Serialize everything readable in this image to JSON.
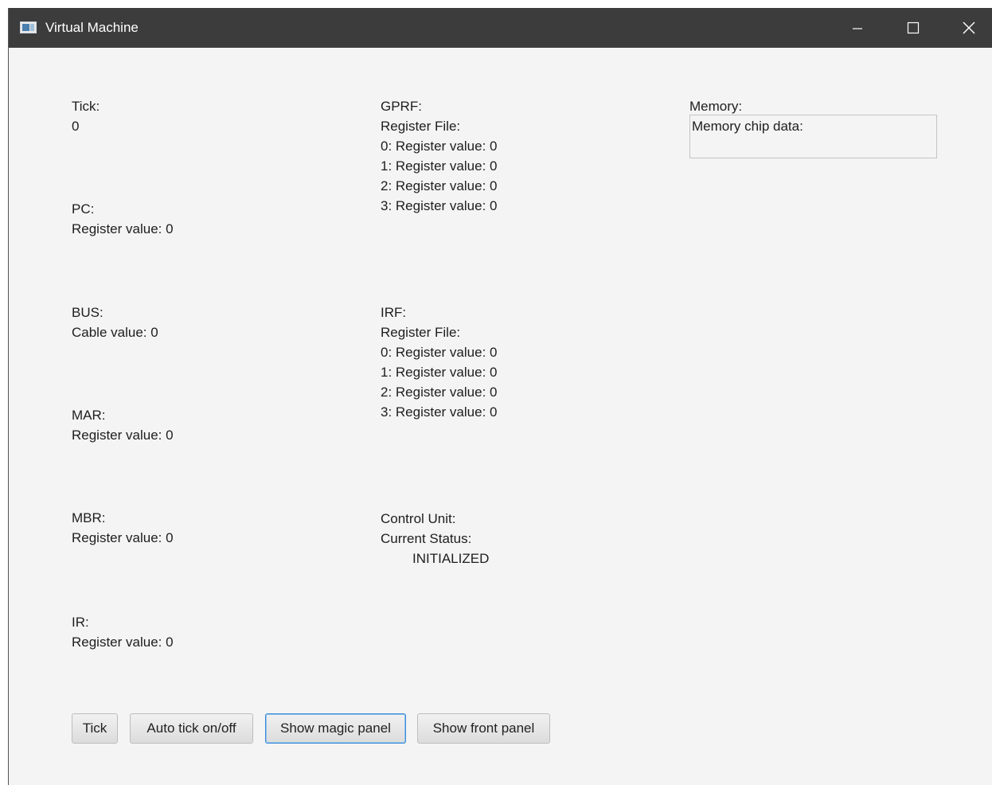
{
  "window": {
    "title": "Virtual Machine",
    "controls": {
      "minimize": "–",
      "maximize": "☐",
      "close": "✕"
    }
  },
  "left_column": {
    "tick": {
      "label": "Tick:",
      "value": "0"
    },
    "pc": {
      "label": "PC:",
      "value": "Register value: 0"
    },
    "bus": {
      "label": "BUS:",
      "value": "Cable value: 0"
    },
    "mar": {
      "label": "MAR:",
      "value": "Register value: 0"
    },
    "mbr": {
      "label": "MBR:",
      "value": "Register value: 0"
    },
    "ir": {
      "label": "IR:",
      "value": "Register value: 0"
    }
  },
  "middle_column": {
    "gprf": {
      "label": "GPRF:",
      "header": "Register File:",
      "registers": [
        "0: Register value: 0",
        "1: Register value: 0",
        "2: Register value: 0",
        "3: Register value: 0"
      ]
    },
    "irf": {
      "label": "IRF:",
      "header": "Register File:",
      "registers": [
        "0: Register value: 0",
        "1: Register value: 0",
        "2: Register value: 0",
        "3: Register value: 0"
      ]
    },
    "control_unit": {
      "label": "Control Unit:",
      "status_label": "Current Status:",
      "status_value": "INITIALIZED"
    }
  },
  "memory": {
    "label": "Memory:",
    "chip_data": "Memory chip data:"
  },
  "buttons": {
    "tick": "Tick",
    "auto_tick": "Auto tick on/off",
    "magic_panel": "Show magic panel",
    "front_panel": "Show front panel"
  },
  "colors": {
    "titlebar": "#3c3c3c",
    "background": "#f4f4f4",
    "focus_border": "#3a8ad6"
  }
}
